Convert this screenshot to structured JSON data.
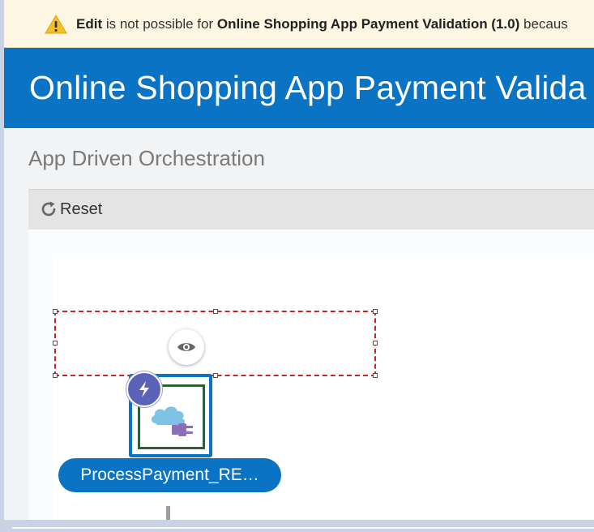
{
  "warning": {
    "action": "Edit",
    "text_mid": " is not possible for ",
    "integration": "Online Shopping App Payment Validation (1.0)",
    "text_tail": " becaus"
  },
  "header": {
    "title": "Online Shopping App Payment Valida"
  },
  "main": {
    "subtitle": "App Driven Orchestration",
    "toolbar": {
      "reset_label": "Reset"
    },
    "canvas": {
      "trigger_node": {
        "label": "ProcessPayment_RE…",
        "icons": [
          "lightning-icon",
          "cloud-adapter-icon",
          "plug-icon"
        ]
      },
      "view_button_icon": "eye-icon"
    }
  },
  "colors": {
    "header_bg": "#0a73c3",
    "warning_bg": "#fcf6e3",
    "warning_icon": "#f2c029",
    "selection_border": "#c1272d",
    "trigger_badge": "#5b63b8",
    "node_border": "#0a73c3"
  }
}
